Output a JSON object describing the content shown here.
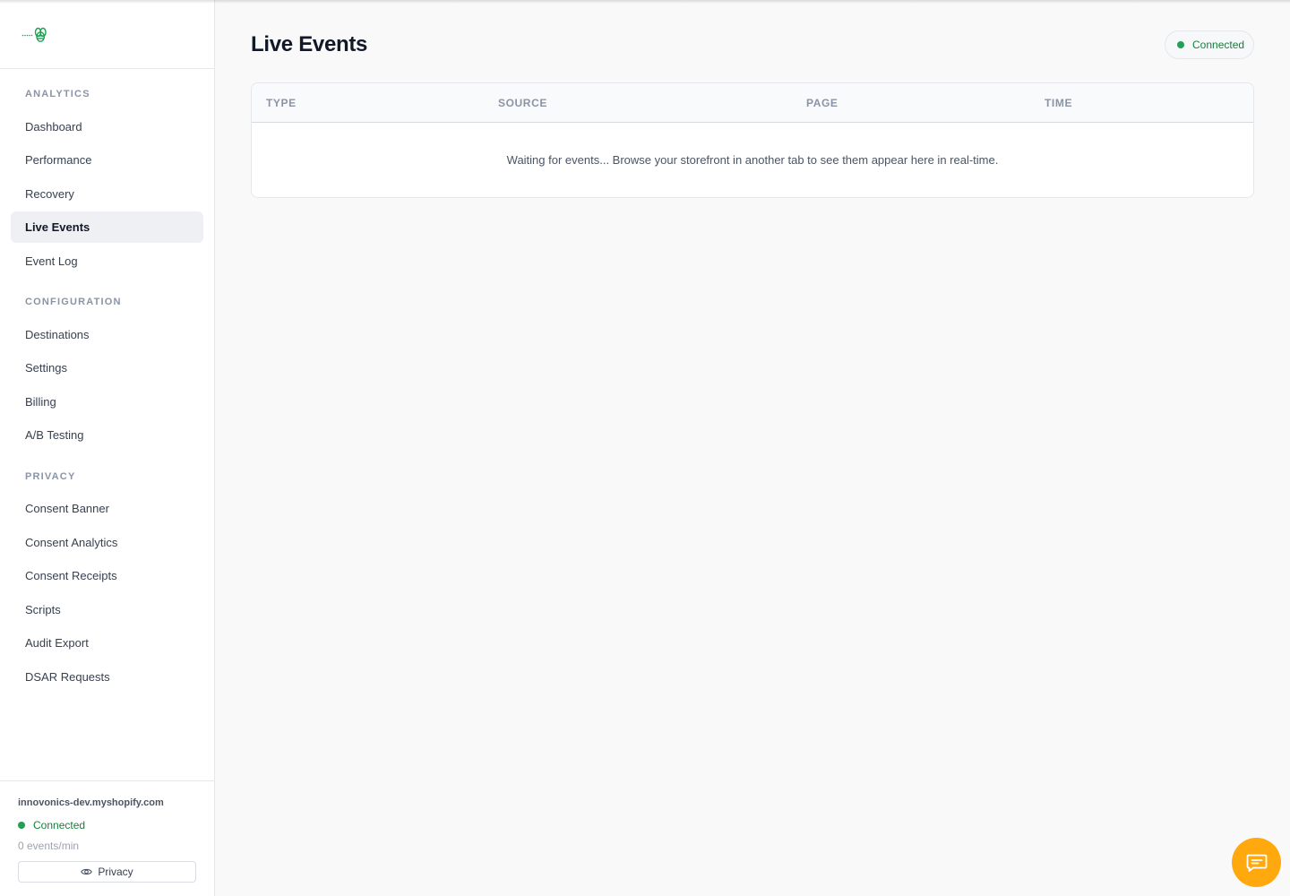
{
  "colors": {
    "accent_green": "#22a055",
    "chat_button": "#ffa90f",
    "active_nav_bg": "#eef0f4"
  },
  "sidebar": {
    "logo_icon": "bee-logo-icon",
    "sections": [
      {
        "title": "ANALYTICS",
        "items": [
          {
            "label": "Dashboard",
            "active": false
          },
          {
            "label": "Performance",
            "active": false
          },
          {
            "label": "Recovery",
            "active": false
          },
          {
            "label": "Live Events",
            "active": true
          },
          {
            "label": "Event Log",
            "active": false
          }
        ]
      },
      {
        "title": "CONFIGURATION",
        "items": [
          {
            "label": "Destinations",
            "active": false
          },
          {
            "label": "Settings",
            "active": false
          },
          {
            "label": "Billing",
            "active": false
          },
          {
            "label": "A/B Testing",
            "active": false
          }
        ]
      },
      {
        "title": "PRIVACY",
        "items": [
          {
            "label": "Consent Banner",
            "active": false
          },
          {
            "label": "Consent Analytics",
            "active": false
          },
          {
            "label": "Consent Receipts",
            "active": false
          },
          {
            "label": "Scripts",
            "active": false
          },
          {
            "label": "Audit Export",
            "active": false
          },
          {
            "label": "DSAR Requests",
            "active": false
          }
        ]
      }
    ],
    "footer": {
      "shop": "innovonics-dev.myshopify.com",
      "status": "Connected",
      "rate": "0 events/min",
      "privacy_label": "Privacy",
      "privacy_icon": "eye-icon"
    }
  },
  "main": {
    "title": "Live Events",
    "connection_status": "Connected",
    "table": {
      "columns": [
        "TYPE",
        "SOURCE",
        "PAGE",
        "TIME"
      ],
      "empty_message": "Waiting for events... Browse your storefront in another tab to see them appear here in real-time."
    }
  },
  "chat": {
    "icon": "chat-icon"
  }
}
